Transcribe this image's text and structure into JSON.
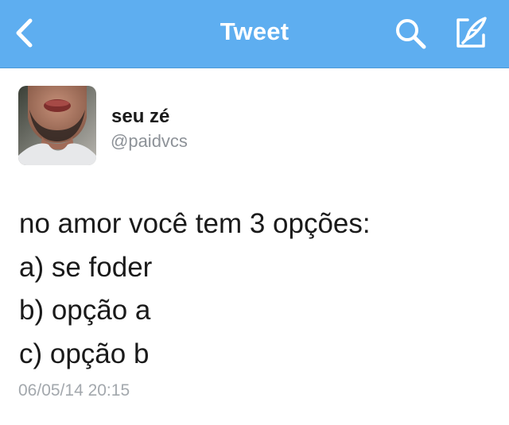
{
  "nav": {
    "title": "Tweet",
    "back_icon": "chevron-left-icon",
    "search_icon": "search-icon",
    "compose_icon": "compose-tweet-icon",
    "background_color": "#5eaef0"
  },
  "tweet": {
    "author": {
      "display_name": "seu zé",
      "handle": "@paidvcs"
    },
    "lines": [
      "no amor você tem 3 opções:",
      "a) se foder",
      "b) opção a",
      "c) opção b"
    ],
    "timestamp": "06/05/14 20:15"
  }
}
